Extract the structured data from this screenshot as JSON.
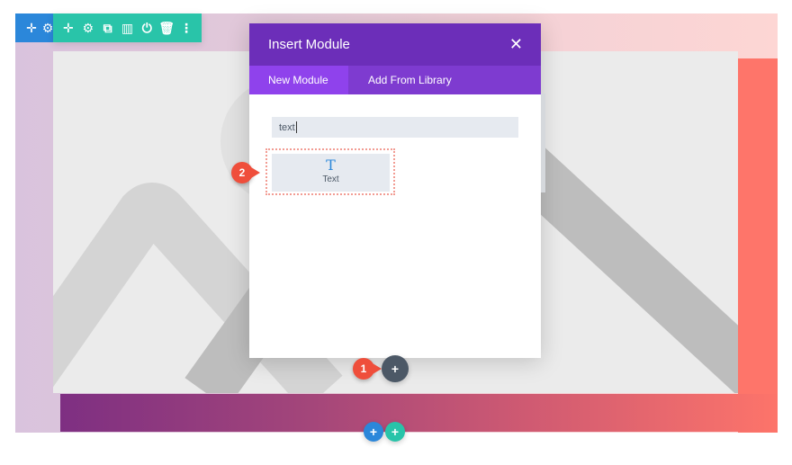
{
  "toolbar": {
    "row_icons": [
      "move-icon",
      "gear-icon"
    ],
    "row_glyphs": [
      "✛",
      "⚙"
    ],
    "module_icons": [
      "move-icon",
      "gear-icon",
      "duplicate-icon",
      "columns-icon",
      "power-icon",
      "trash-icon",
      "more-icon"
    ],
    "module_glyphs": [
      "✛",
      "⚙",
      "⧉",
      "▥",
      "⏻",
      "🗑",
      "⋮"
    ]
  },
  "modal": {
    "title": "Insert Module",
    "close_glyph": "✕",
    "tabs": [
      {
        "label": "New Module",
        "active": true
      },
      {
        "label": "Add From Library",
        "active": false
      }
    ],
    "search": {
      "value": "text",
      "placeholder": ""
    },
    "results": [
      {
        "icon": "text-icon",
        "glyph": "T",
        "label": "Text"
      }
    ]
  },
  "callouts": [
    {
      "number": "1"
    },
    {
      "number": "2"
    }
  ],
  "buttons": {
    "add_module": "+",
    "add_row": "+",
    "add_section": "+"
  },
  "colors": {
    "modal_header": "#6c2eb9",
    "modal_tabs": "#7e3bd0",
    "active_tab": "#8f42ec",
    "row_toolbar": "#2b87da",
    "module_toolbar": "#29c4a9",
    "callout": "#ef4e3b",
    "add_module": "#4c5866"
  }
}
